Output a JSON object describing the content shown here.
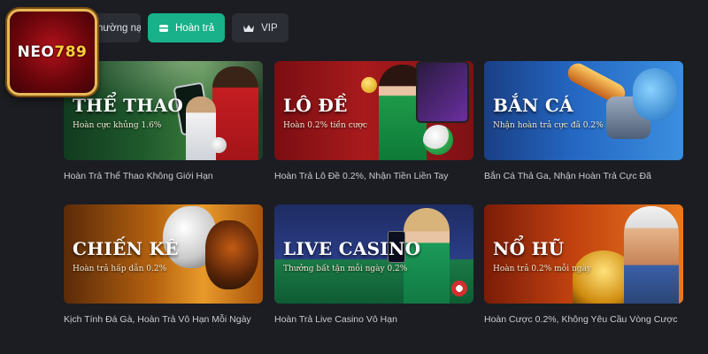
{
  "logo": {
    "text_a": "NEO",
    "text_b": "789"
  },
  "tabs": [
    {
      "label": "hường nạp",
      "icon": "gift-icon",
      "active": false
    },
    {
      "label": "Hoàn trả",
      "icon": "refund-icon",
      "active": true
    },
    {
      "label": "VIP",
      "icon": "crown-icon",
      "active": false
    }
  ],
  "colors": {
    "background": "#1b1d22",
    "accent": "#18b189",
    "tab_bg": "#2b2e35"
  },
  "cards": [
    {
      "title": "THỂ THAO",
      "subtitle": "Hoàn cực khủng 1.6%",
      "caption": "Hoàn Trả Thể Thao Không Giới Hạn"
    },
    {
      "title": "LÔ ĐỀ",
      "subtitle": "Hoàn 0.2% tiền cược",
      "caption": "Hoàn Trả Lô Đề 0.2%, Nhận Tiền Liền Tay"
    },
    {
      "title": "BẮN CÁ",
      "subtitle": "Nhận hoàn trả cực đã 0.2%",
      "caption": "Bắn Cá Thả Ga, Nhận Hoàn Trả Cực Đã"
    },
    {
      "title": "CHIẾN KÊ",
      "subtitle": "Hoàn trả hấp dẫn 0.2%",
      "caption": "Kịch Tính Đá Gà, Hoàn Trả Vô Hạn Mỗi Ngày"
    },
    {
      "title": "LIVE CASINO",
      "subtitle": "Thưởng bất tận mỗi ngày 0.2%",
      "caption": "Hoàn Trả Live Casino Vô Hạn"
    },
    {
      "title": "NỔ HŨ",
      "subtitle": "Hoàn trả 0.2% mỗi ngày",
      "caption": "Hoàn Cược 0.2%, Không Yêu Cầu Vòng Cược"
    }
  ]
}
